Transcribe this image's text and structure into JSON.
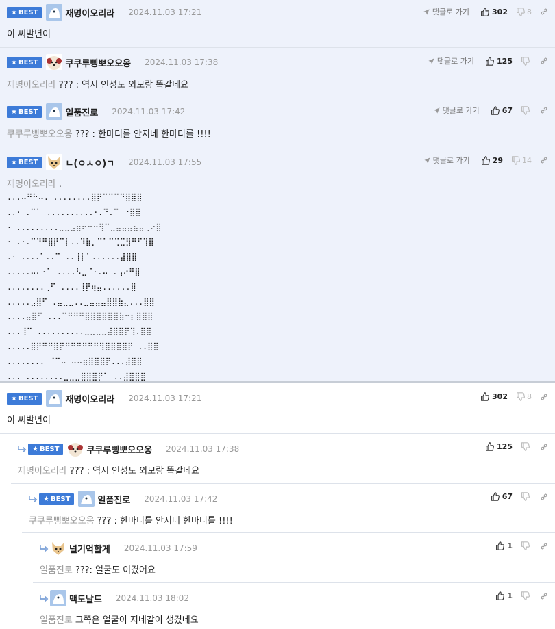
{
  "labels": {
    "best": "BEST",
    "goto": "댓글로 가기"
  },
  "best_comments": [
    {
      "nick": "재명이오리라",
      "time": "2024.11.03 17:21",
      "likes": "302",
      "dislikes": "8",
      "ref": "",
      "text": "이 씨발년이",
      "avatar": "blue"
    },
    {
      "nick": "쿠쿠루삥뽀오오옹",
      "time": "2024.11.03 17:38",
      "likes": "125",
      "dislikes": "",
      "ref": "재명이오리라",
      "text": "??? : 역시 인성도 외모랑 똑같네요",
      "avatar": "dog"
    },
    {
      "nick": "일품진로",
      "time": "2024.11.03 17:42",
      "likes": "67",
      "dislikes": "",
      "ref": "쿠쿠루삥뽀오오옹",
      "text": "??? : 한마디를 안지네 한마디를 !!!!",
      "avatar": "blue"
    },
    {
      "nick": "ㄴ(ㅇㅅㅇ)ㄱ",
      "time": "2024.11.03 17:55",
      "likes": "29",
      "dislikes": "14",
      "ref": "재명이오리라",
      "text": ".",
      "avatar": "cat",
      "ascii": [
        "...⠤⠛⠓⠤. ........⣿⡟⠉⠉⠉⠙⣿⣿⣿",
        "..· .⠉⠁ ..........·.⠙.⠉ ⠐⣿⣿",
        "· .........⣀⣀⣠⣶⠖⠒⠒⢻⠉⣀⣤⣤⣤⣦⣤⢀⠔⣿",
        "· .·.⠉⠙⠛⣿⡟⠉⡇..⠹⣷⡀⠉⠁⠉⢉⣉⣻⠛⠋⢹⣿",
        ".· ....⠁..⠉ ..⢸⡇⠁......⣼⣿⣿",
        ".....⠤⠄·⠁ ....⠣⣀⠈·.⠤ .⢠⠔⠛⣿",
        "........⢀⠋ ....⢸⡟⢶⣤......⣿",
        ".....⣠⣿⠋ .⣤⣀⣀..⣀⣤⣤⣤⣿⣿⣷⣄...⣿⣿",
        "....⣤⣿⠋ ...⠉⠛⠛⠛⣿⣿⣿⣿⣿⣿⣷⠒⡆⣿⣿⣿",
        "...⢸⠉ ..........⣀⣀⣀⣀⣼⣿⣿⡟⢹.⣿⣿",
        ".....⣿⡟⠛⠛⣿⡟⠛⠛⠛⠛⠛⠛⢻⣿⣿⣿⣿⡟ ..⣿⣿",
        "........ ⠈⠉⠤ ⠤⠤⣶⣿⣿⣿⡟...⣼⣿⣿",
        "... ........⣀⣀⣀⣿⣿⣿⡟⠁ ..⣼⣿⣿⣿"
      ]
    }
  ],
  "thread": [
    {
      "nick": "재명이오리라",
      "time": "2024.11.03 17:21",
      "likes": "302",
      "dislikes": "8",
      "ref": "",
      "text": "이 씨발년이",
      "best": true,
      "avatar": "blue"
    },
    {
      "nick": "쿠쿠루삥뽀오오옹",
      "time": "2024.11.03 17:38",
      "likes": "125",
      "dislikes": "",
      "ref": "재명이오리라",
      "text": "??? : 역시 인성도 외모랑 똑같네요",
      "best": true,
      "avatar": "dog"
    },
    {
      "nick": "일품진로",
      "time": "2024.11.03 17:42",
      "likes": "67",
      "dislikes": "",
      "ref": "쿠쿠루삥뽀오오옹",
      "text": "??? : 한마디를 안지네 한마디를 !!!!",
      "best": true,
      "avatar": "blue"
    },
    {
      "nick": "널기억할게",
      "time": "2024.11.03 17:59",
      "likes": "1",
      "dislikes": "",
      "ref": "일품진로",
      "text": "???: 얼굴도 이겼어요",
      "best": false,
      "avatar": "cat"
    },
    {
      "nick": "맥도날드",
      "time": "2024.11.03 18:02",
      "likes": "1",
      "dislikes": "",
      "ref": "일품진로",
      "text": "그쪽은 얼굴이 지네같이 생겼네요",
      "best": false,
      "avatar": "blue"
    }
  ],
  "colors": {
    "badge": "#3d7bd8",
    "best_bg": "#eef2fb",
    "ref": "#999999"
  }
}
